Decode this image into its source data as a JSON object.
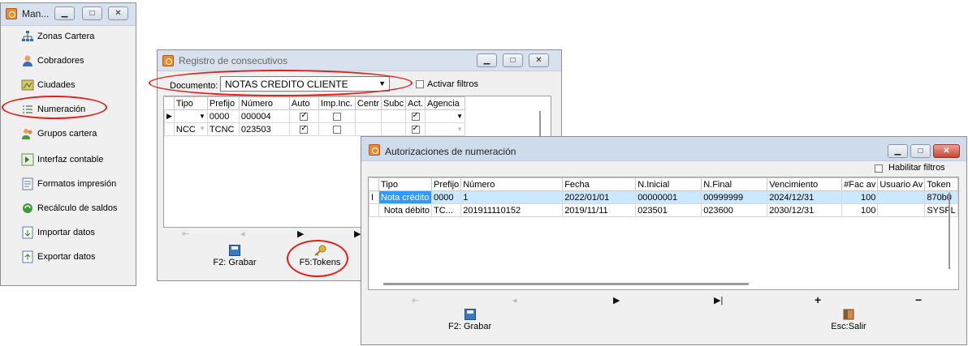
{
  "menu_window": {
    "title": "Man...",
    "items": [
      {
        "label": "Zonas Cartera",
        "icon": "hierarchy-icon"
      },
      {
        "label": "Cobradores",
        "icon": "user-icon"
      },
      {
        "label": "Ciudades",
        "icon": "map-icon"
      },
      {
        "label": "Numeración",
        "icon": "list-icon"
      },
      {
        "label": "Grupos cartera",
        "icon": "users-icon"
      },
      {
        "label": "Interfaz contable",
        "icon": "arrow-box-icon"
      },
      {
        "label": "Formatos impresión",
        "icon": "document-icon"
      },
      {
        "label": "Recálculo de saldos",
        "icon": "refresh-icon"
      },
      {
        "label": "Importar datos",
        "icon": "import-icon"
      },
      {
        "label": "Exportar datos",
        "icon": "export-icon"
      }
    ]
  },
  "registro": {
    "title": "Registro de consecutivos",
    "documento_label": "Documento:",
    "documento_value": "NOTAS CREDITO CLIENTE",
    "filtros_label": "Activar filtros",
    "columns": [
      "Tipo",
      "Prefijo",
      "Número",
      "Auto",
      "Imp.Inc.",
      "Centr",
      "Subc",
      "Act.",
      "Agencia"
    ],
    "rows": [
      {
        "tipo": "",
        "prefijo": "0000",
        "numero": "000004",
        "auto": true,
        "imp": false,
        "act": true
      },
      {
        "tipo": "NCC",
        "prefijo": "TCNC",
        "numero": "023503",
        "auto": true,
        "imp": false,
        "act": true
      }
    ],
    "grabar_label": "F2: Grabar",
    "tokens_label": "F5:Tokens"
  },
  "autorizaciones": {
    "title": "Autorizaciones de numeración",
    "filtros_label": "Habilitar filtros",
    "columns": [
      "Tipo",
      "Prefijo",
      "Número",
      "Fecha",
      "N.Inicial",
      "N.Final",
      "Vencimiento",
      "#Fac av",
      "Usuario Av",
      "Token"
    ],
    "rows": [
      {
        "tipo": "Nota crédito",
        "prefijo": "0000",
        "numero": "1",
        "fecha": "2022/01/01",
        "inicial": "00000001",
        "final": "00999999",
        "venc": "2024/12/31",
        "fac": "100",
        "usuario": "",
        "token": "870b0"
      },
      {
        "tipo": "Nota débito",
        "prefijo": "TC...",
        "numero": "201911110152",
        "fecha": "2019/11/11",
        "inicial": "023501",
        "final": "023600",
        "venc": "2030/12/31",
        "fac": "100",
        "usuario": "",
        "token": "SYSPL"
      }
    ],
    "grabar_label": "F2: Grabar",
    "salir_label": "Esc:Salir"
  },
  "colors": {
    "highlight_ring": "#e0201c",
    "selected_row": "#cce8ff",
    "accent": "#3b79c4"
  }
}
